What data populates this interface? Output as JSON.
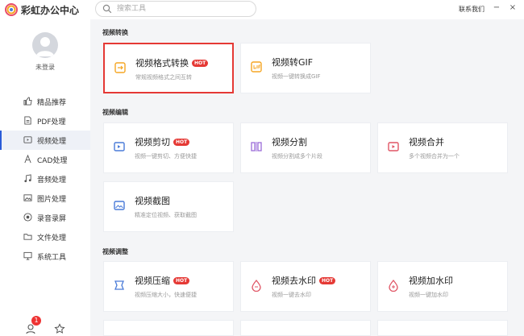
{
  "app": {
    "title": "彩虹办公中心",
    "contact_label": "联系我们"
  },
  "search": {
    "placeholder": "搜索工具"
  },
  "window_controls": {
    "minimize": "−",
    "close": "×"
  },
  "user": {
    "status": "未登录"
  },
  "sidebar": {
    "items": [
      {
        "label": "精品推荐",
        "icon": "thumbs-up-icon",
        "active": false
      },
      {
        "label": "PDF处理",
        "icon": "pdf-icon",
        "active": false
      },
      {
        "label": "视频处理",
        "icon": "video-icon",
        "active": true
      },
      {
        "label": "CAD处理",
        "icon": "cad-icon",
        "active": false
      },
      {
        "label": "音频处理",
        "icon": "music-icon",
        "active": false
      },
      {
        "label": "图片处理",
        "icon": "image-icon",
        "active": false
      },
      {
        "label": "录音录屏",
        "icon": "record-icon",
        "active": false
      },
      {
        "label": "文件处理",
        "icon": "folder-icon",
        "active": false
      },
      {
        "label": "系统工具",
        "icon": "system-icon",
        "active": false
      }
    ],
    "notification_count": "1"
  },
  "sections": [
    {
      "title": "视频转换",
      "cards": [
        {
          "title": "视频格式转换",
          "hot": "HOT",
          "desc": "常规视频格式之间互转",
          "icon": "video-convert-icon",
          "color": "#f5a623"
        },
        {
          "title": "视频转GIF",
          "hot": "",
          "desc": "视频一键转换成GIF",
          "icon": "gif-icon",
          "color": "#f5a623"
        }
      ]
    },
    {
      "title": "视频编辑",
      "cards": [
        {
          "title": "视频剪切",
          "hot": "HOT",
          "desc": "视频一键剪切、方便快捷",
          "icon": "video-cut-icon",
          "color": "#4a7bd8"
        },
        {
          "title": "视频分割",
          "hot": "",
          "desc": "视频分割成多个片段",
          "icon": "video-split-icon",
          "color": "#9b6cd8"
        },
        {
          "title": "视频合并",
          "hot": "",
          "desc": "多个视频合并为一个",
          "icon": "video-merge-icon",
          "color": "#e05565"
        },
        {
          "title": "视频截图",
          "hot": "",
          "desc": "精准定位视频、获取截图",
          "icon": "video-screenshot-icon",
          "color": "#4a7bd8"
        }
      ]
    },
    {
      "title": "视频调整",
      "cards": [
        {
          "title": "视频压缩",
          "hot": "HOT",
          "desc": "视频压缩大小，快速便捷",
          "icon": "video-compress-icon",
          "color": "#4a7bd8"
        },
        {
          "title": "视频去水印",
          "hot": "HOT",
          "desc": "视频一键去水印",
          "icon": "watermark-remove-icon",
          "color": "#e05565"
        },
        {
          "title": "视频加水印",
          "hot": "",
          "desc": "视频一键加水印",
          "icon": "watermark-add-icon",
          "color": "#e05565"
        }
      ]
    }
  ],
  "colors": {
    "accent": "#2a5cd8",
    "hot_badge": "#e53935",
    "selected_border": "#e53935"
  }
}
